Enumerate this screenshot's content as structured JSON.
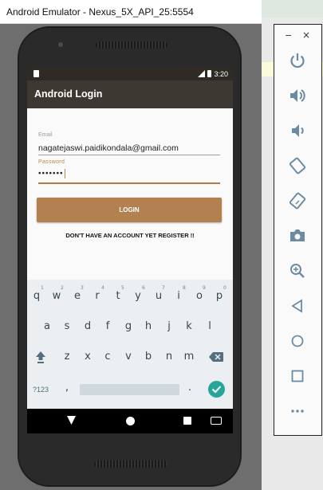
{
  "window": {
    "title": "Android Emulator - Nexus_5X_API_25:5554"
  },
  "status_bar": {
    "time": "3:20"
  },
  "app": {
    "title": "Android Login",
    "email_label": "Email",
    "email_value": "nagatejaswi.paidikondala@gmail.com",
    "password_label": "Password",
    "password_value": "•••••••",
    "login_button": "LOGIN",
    "register_link": "DON'T HAVE AN ACCOUNT YET REGISTER !!"
  },
  "keyboard": {
    "row1": [
      "q",
      "w",
      "e",
      "r",
      "t",
      "y",
      "u",
      "i",
      "o",
      "p"
    ],
    "row1_hints": [
      "1",
      "2",
      "3",
      "4",
      "5",
      "6",
      "7",
      "8",
      "9",
      "0"
    ],
    "row2": [
      "a",
      "s",
      "d",
      "f",
      "g",
      "h",
      "j",
      "k",
      "l"
    ],
    "row3": [
      "z",
      "x",
      "c",
      "v",
      "b",
      "n",
      "m"
    ],
    "symbols_key": "?123",
    "comma_key": ",",
    "period_key": ".",
    "accent_color": "#26a69a"
  },
  "controls": {
    "minimize": "−",
    "close": "×",
    "icons": [
      "power-icon",
      "volume-up-icon",
      "volume-down-icon",
      "rotate-left-icon",
      "rotate-right-icon",
      "camera-icon",
      "zoom-icon",
      "back-icon",
      "home-icon",
      "overview-icon",
      "more-icon"
    ],
    "icon_color": "#6b8ba4"
  },
  "theme": {
    "toolbar_color": "#3d3831",
    "button_color": "#b38150"
  }
}
